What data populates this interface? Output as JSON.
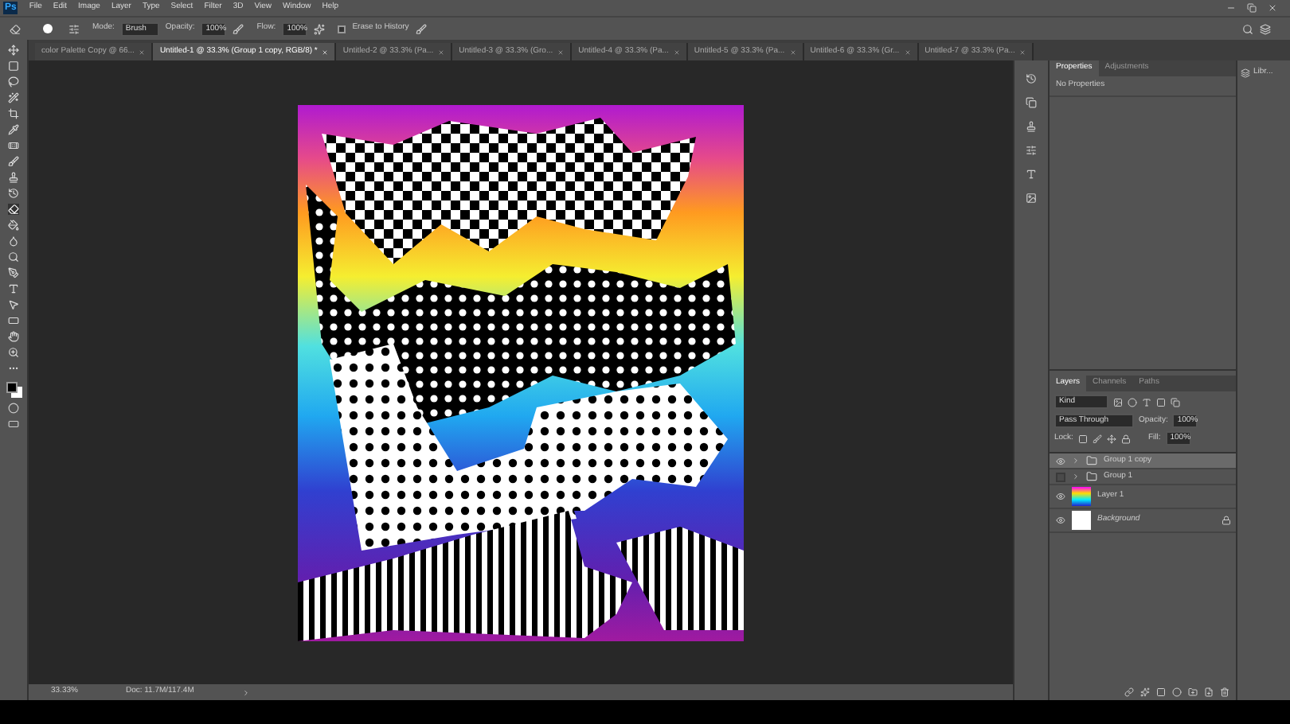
{
  "menu": {
    "logo": "Ps",
    "items": [
      "File",
      "Edit",
      "Image",
      "Layer",
      "Type",
      "Select",
      "Filter",
      "3D",
      "View",
      "Window",
      "Help"
    ]
  },
  "options_bar": {
    "mode_label": "Mode:",
    "mode": "Brush",
    "opacity_label": "Opacity:",
    "opacity": "100%",
    "flow_label": "Flow:",
    "flow": "100%",
    "erase_to_history": {
      "label": "Erase to History",
      "checked": false
    }
  },
  "tabs": [
    {
      "label": "color Palette Copy @ 66...",
      "selected": false
    },
    {
      "label": "Untitled-1 @ 33.3% (Group 1 copy, RGB/8) *",
      "selected": true
    },
    {
      "label": "Untitled-2 @ 33.3% (Pa...",
      "selected": false
    },
    {
      "label": "Untitled-3 @ 33.3% (Gro...",
      "selected": false
    },
    {
      "label": "Untitled-4 @ 33.3% (Pa...",
      "selected": false
    },
    {
      "label": "Untitled-5 @ 33.3% (Pa...",
      "selected": false
    },
    {
      "label": "Untitled-6 @ 33.3% (Gr...",
      "selected": false
    },
    {
      "label": "Untitled-7 @ 33.3% (Pa...",
      "selected": false
    }
  ],
  "properties_panel": {
    "tabs": [
      {
        "label": "Properties",
        "selected": true
      },
      {
        "label": "Adjustments",
        "selected": false
      }
    ],
    "content": "No Properties"
  },
  "libraries_panel": {
    "label": "Libr..."
  },
  "layers_panel": {
    "tabs": [
      {
        "label": "Layers",
        "selected": true
      },
      {
        "label": "Channels",
        "selected": false
      },
      {
        "label": "Paths",
        "selected": false
      }
    ],
    "filter": "Kind",
    "blend_mode": "Pass Through",
    "opacity_label": "Opacity:",
    "opacity": "100%",
    "lock_label": "Lock:",
    "fill_label": "Fill:",
    "fill": "100%",
    "layers": [
      {
        "name": "Group 1 copy",
        "kind": "group",
        "visible": true,
        "selected": true
      },
      {
        "name": "Group 1",
        "kind": "group",
        "visible": false,
        "selected": false
      },
      {
        "name": "Layer 1",
        "kind": "image",
        "visible": true,
        "selected": false
      },
      {
        "name": "Background",
        "kind": "background",
        "visible": true,
        "selected": false
      }
    ]
  },
  "status_bar": {
    "zoom": "33.33%",
    "doc": "Doc: 11.7M/117.4M"
  }
}
